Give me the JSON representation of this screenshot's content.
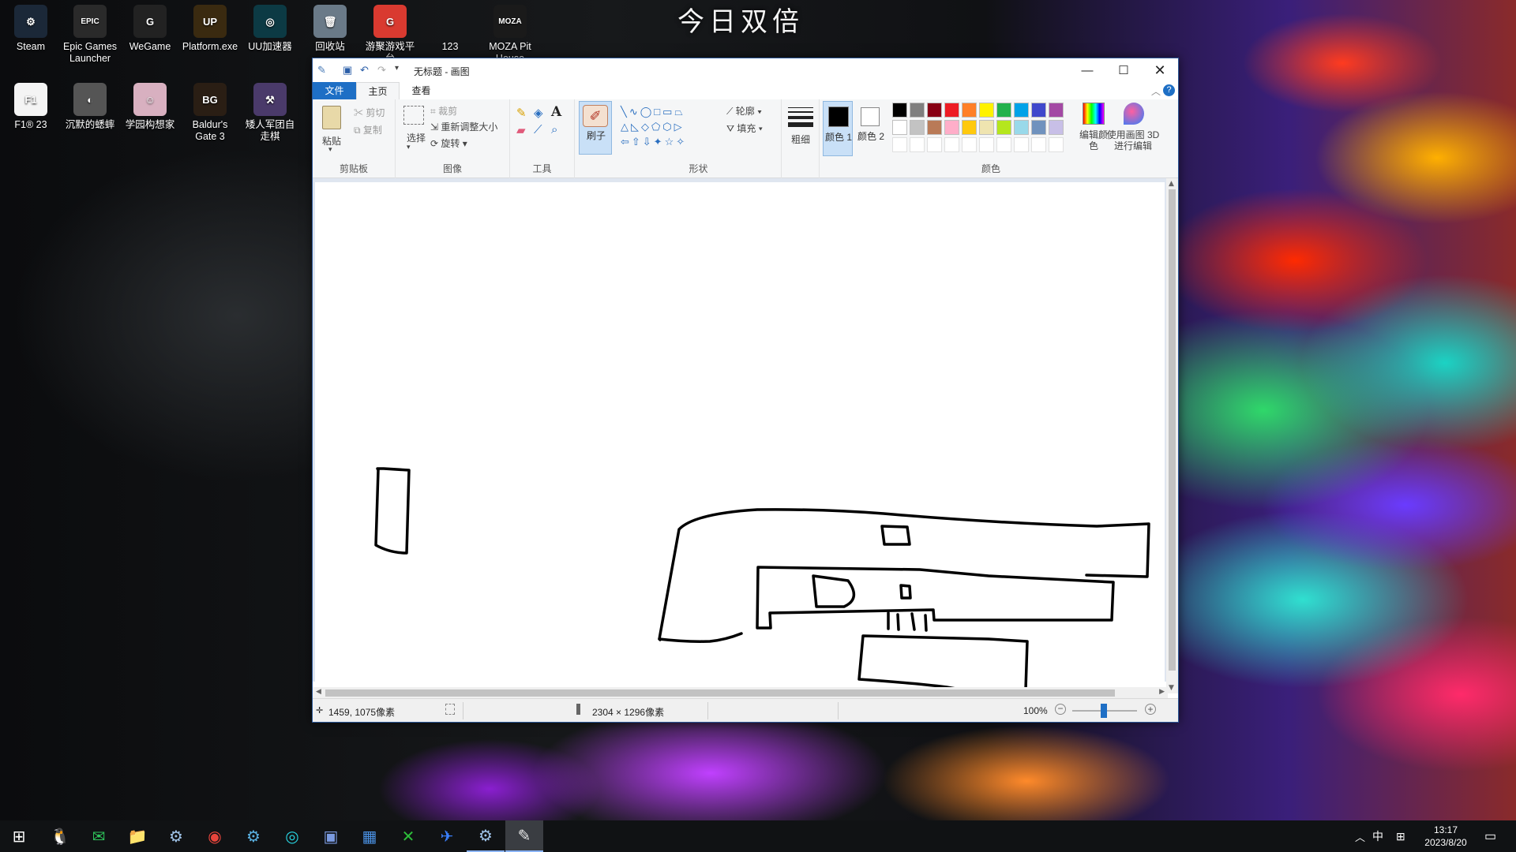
{
  "banner": "今日双倍",
  "desktop_icons": [
    {
      "label": "Steam",
      "icon": "steam-icon",
      "color": "#1b2838",
      "glyph": "⚙"
    },
    {
      "label": "Epic Games Launcher",
      "icon": "epic-games-icon",
      "color": "#2a2a2a",
      "glyph": "EPIC"
    },
    {
      "label": "WeGame",
      "icon": "wegame-icon",
      "color": "#222222",
      "glyph": "G"
    },
    {
      "label": "Platform.exe",
      "icon": "platform-icon",
      "color": "#3a2a10",
      "glyph": "UP"
    },
    {
      "label": "UU加速器",
      "icon": "uu-accelerator-icon",
      "color": "#0c3a44",
      "glyph": "◎"
    },
    {
      "label": "回收站",
      "icon": "recycle-bin-icon",
      "color": "#6a7a88",
      "glyph": "🗑"
    },
    {
      "label": "游聚游戏平台",
      "icon": "youju-platform-icon",
      "color": "#d93a30",
      "glyph": "G"
    },
    {
      "label": "123",
      "icon": "folder-123-icon",
      "color": "transparent",
      "glyph": ""
    },
    {
      "label": "MOZA Pit House",
      "icon": "moza-icon",
      "color": "#1a1a1a",
      "glyph": "MOZA"
    },
    {
      "label": "F1® 23",
      "icon": "f1-23-icon",
      "color": "#f4f4f4",
      "glyph": "F1"
    },
    {
      "label": "沉默的蟋蟀",
      "icon": "silent-cricket-icon",
      "color": "#555555",
      "glyph": "◐"
    },
    {
      "label": "学园构想家",
      "icon": "academy-icon",
      "color": "#d8b0c0",
      "glyph": "☺"
    },
    {
      "label": "Baldur's Gate 3",
      "icon": "baldurs-gate-icon",
      "color": "#2a1e14",
      "glyph": "BG"
    },
    {
      "label": "矮人军团自走棋",
      "icon": "dwarf-chess-icon",
      "color": "#4a3a6a",
      "glyph": "⚒"
    }
  ],
  "paint": {
    "title": "无标题 - 画图",
    "tabs": {
      "file": "文件",
      "home": "主页",
      "view": "查看"
    },
    "clipboard": {
      "paste": "粘贴",
      "cut": "剪切",
      "copy": "复制",
      "group": "剪贴板"
    },
    "image": {
      "select": "选择",
      "crop": "裁剪",
      "resize": "重新调整大小",
      "rotate": "旋转",
      "group": "图像"
    },
    "tools": {
      "group": "工具"
    },
    "brushes": {
      "label": "刷子"
    },
    "shapes": {
      "outline": "轮廓",
      "fill": "填充",
      "group": "形状"
    },
    "size": {
      "label": "粗细"
    },
    "colors": {
      "color1": "颜色 1",
      "color2": "颜色 2",
      "edit": "编辑颜色",
      "paint3d": "使用画图 3D 进行编辑",
      "group": "颜色",
      "color1_value": "#000000",
      "color2_value": "#ffffff",
      "palette_row1": [
        "#000000",
        "#7f7f7f",
        "#880015",
        "#ed1c24",
        "#ff7f27",
        "#fff200",
        "#22b14c",
        "#00a2e8",
        "#3f48cc",
        "#a349a4"
      ],
      "palette_row2": [
        "#ffffff",
        "#c3c3c3",
        "#b97a57",
        "#ffaec9",
        "#ffc90e",
        "#efe4b0",
        "#b5e61d",
        "#99d9ea",
        "#7092be",
        "#c8bfe7"
      ]
    },
    "status": {
      "cursor": "1459, 1075像素",
      "size": "2304 × 1296像素",
      "zoom": "100%"
    }
  },
  "taskbar": {
    "apps": [
      "start-icon",
      "qq-icon",
      "wechat-icon",
      "file-explorer-icon",
      "steam-icon",
      "chrome-icon",
      "settings-icon",
      "uu-accelerator-icon",
      "photos-icon",
      "store-icon",
      "xbox-icon",
      "feishu-icon",
      "steam-icon",
      "paint-icon"
    ],
    "ime": "中",
    "time": "13:17",
    "date": "2023/8/20"
  }
}
